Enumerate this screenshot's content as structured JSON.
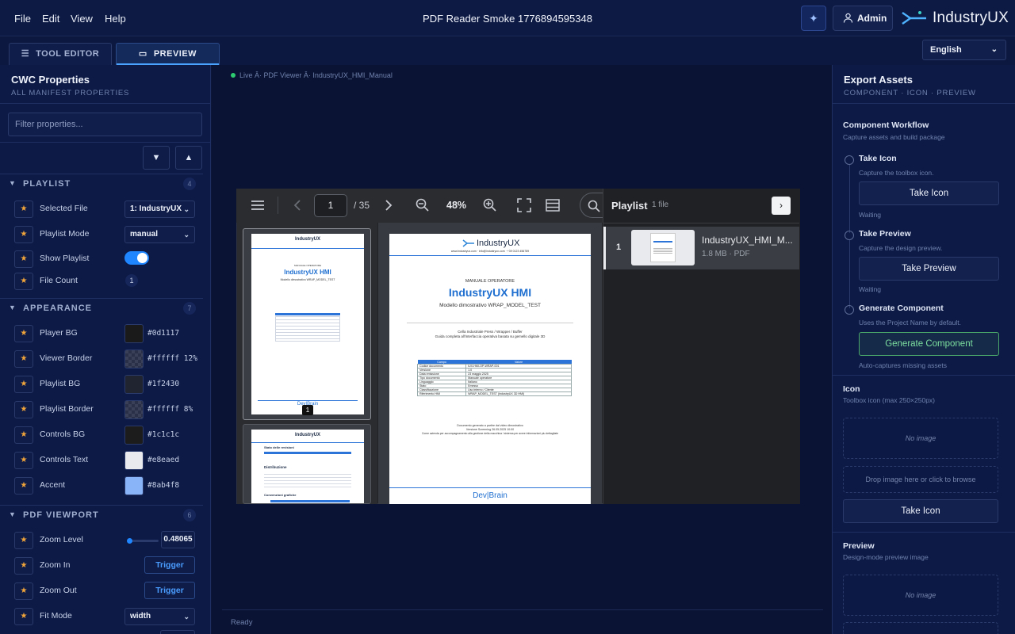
{
  "menu": [
    "File",
    "Edit",
    "View",
    "Help"
  ],
  "window_title": "PDF Reader Smoke 1776894595348",
  "admin_label": "Admin",
  "brand": "IndustryUX",
  "tabs": {
    "tool_editor": "TOOL EDITOR",
    "preview": "PREVIEW"
  },
  "language": "English",
  "left": {
    "title": "CWC Properties",
    "subtitle": "ALL MANIFEST PROPERTIES",
    "filter_placeholder": "Filter properties...",
    "playlist": {
      "label": "PLAYLIST",
      "count": "4",
      "selected_file_label": "Selected File",
      "selected_file": "1: IndustryUX",
      "mode_label": "Playlist Mode",
      "mode": "manual",
      "show_label": "Show Playlist",
      "file_count_label": "File Count",
      "file_count": "1"
    },
    "appearance": {
      "label": "APPEARANCE",
      "count": "7",
      "items": [
        {
          "name": "Player BG",
          "value": "#0d1117",
          "color": "#1a1a1a"
        },
        {
          "name": "Viewer Border",
          "value": "#ffffff 12%",
          "color": "check"
        },
        {
          "name": "Playlist BG",
          "value": "#1f2430",
          "color": "#1f2430"
        },
        {
          "name": "Playlist Border",
          "value": "#ffffff 8%",
          "color": "check"
        },
        {
          "name": "Controls BG",
          "value": "#1c1c1c",
          "color": "#1c1c1c"
        },
        {
          "name": "Controls Text",
          "value": "#e8eaed",
          "color": "#e8eaed"
        },
        {
          "name": "Accent",
          "value": "#8ab4f8",
          "color": "#8ab4f8"
        }
      ]
    },
    "viewport": {
      "label": "PDF VIEWPORT",
      "count": "6",
      "zoom_level_label": "Zoom Level",
      "zoom_level": "0.48065",
      "zoom_in_label": "Zoom In",
      "zoom_out_label": "Zoom Out",
      "trigger": "Trigger",
      "fit_mode_label": "Fit Mode",
      "fit_mode": "width"
    }
  },
  "center": {
    "breadcrumb": "Live Â· PDF Viewer Â· IndustryUX_HMI_Manual",
    "status": "Ready"
  },
  "viewer": {
    "page": "1",
    "total_pages": "/ 35",
    "zoom": "48%",
    "thumb_page_badge": "1",
    "doc": {
      "brand": "IndustryUX",
      "header_line": "www.industryux.com · info@industryux.com · +39 0123 456789",
      "kicker": "MANUALE OPERATORE",
      "title": "IndustryUX HMI",
      "model": "Modello dimostrativo  WRAP_MODEL_TEST",
      "line1": "Cella Industriale Press / Wrapper / Buffer",
      "line2": "Guida completa all'interfaccia operativa basata su gemello digitale 3D",
      "table_head": [
        "Campo",
        "Valore"
      ],
      "table_rows": [
        [
          "Codice documento",
          "IUX-HMI-OP-WRAP-001"
        ],
        [
          "Versione",
          "1.0"
        ],
        [
          "Data emissione",
          "23 maggio 2025"
        ],
        [
          "Tipo documento",
          "Manuale operatore"
        ],
        [
          "Linguaggio",
          "Italiano"
        ],
        [
          "Stato",
          "Emesso"
        ],
        [
          "Classificazione",
          "Uso interno / Cliente"
        ],
        [
          "Riferimento HMI",
          "WRAP_MODEL_TEST (IndustryUX 3D HMI)"
        ]
      ],
      "footer1": "Documento generato a partire dal video dimostrativo",
      "footer2": "Versione Screening 26.05.2025 10:00",
      "footer3": "Come azienda per accompagnamento alla gestione della macchina / sistema per avere informazioni piu dettagliate",
      "footer_brand": "Dev|Brain",
      "p2_section": "Stato delle revisioni",
      "p2_distribution": "Distribuzione",
      "p2_conventions": "Convenzioni grafiche"
    }
  },
  "playlist": {
    "title": "Playlist",
    "count": "1 file",
    "item": {
      "index": "1",
      "name": "IndustryUX_HMI_M...",
      "meta": "1.8 MB · PDF"
    }
  },
  "right": {
    "title": "Export Assets",
    "subtitle": "COMPONENT · ICON · PREVIEW",
    "workflow_title": "Component Workflow",
    "workflow_sub": "Capture assets and build package",
    "steps": [
      {
        "title": "Take Icon",
        "sub": "Capture the toolbox icon.",
        "button": "Take Icon",
        "status": "Waiting"
      },
      {
        "title": "Take Preview",
        "sub": "Capture the design preview.",
        "button": "Take Preview",
        "status": "Waiting"
      },
      {
        "title": "Generate Component",
        "sub": "Uses the Project Name by default.",
        "button": "Generate Component",
        "status": "Auto-captures missing assets"
      }
    ],
    "icon_title": "Icon",
    "icon_sub": "Toolbox icon (max 250×250px)",
    "no_image": "No image",
    "drop_text": "Drop image here or click to browse",
    "take_icon": "Take Icon",
    "preview_title": "Preview",
    "preview_sub": "Design-mode preview image"
  },
  "colors": {
    "accent": "#1f86ff",
    "bg": "#0b1638",
    "panel": "#0d1a46",
    "star": "#f2a63a"
  }
}
